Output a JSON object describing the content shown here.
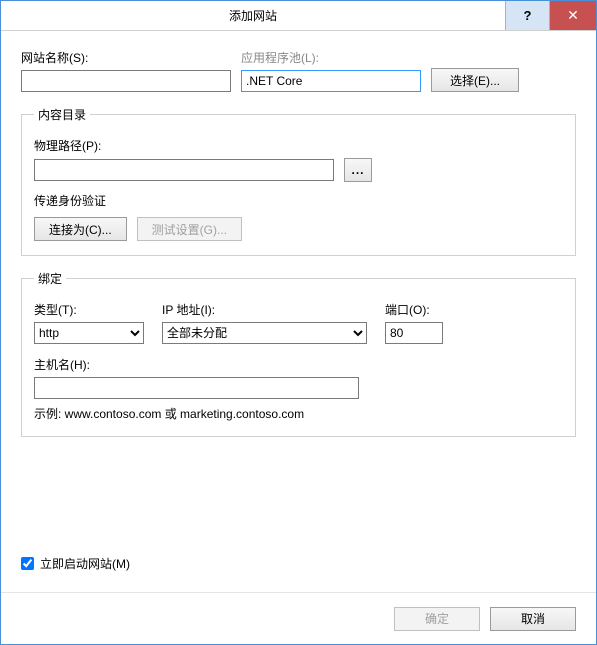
{
  "titlebar": {
    "title": "添加网站",
    "help": "?",
    "close": "✕"
  },
  "site": {
    "name_label": "网站名称(S):",
    "name_value": "",
    "apppool_label": "应用程序池(L):",
    "apppool_value": ".NET Core",
    "select_btn": "选择(E)..."
  },
  "content_dir": {
    "legend": "内容目录",
    "path_label": "物理路径(P):",
    "path_value": "",
    "browse_btn": "...",
    "auth_label": "传递身份验证",
    "connect_as_btn": "连接为(C)...",
    "test_btn": "测试设置(G)..."
  },
  "binding": {
    "legend": "绑定",
    "type_label": "类型(T):",
    "type_value": "http",
    "ip_label": "IP 地址(I):",
    "ip_value": "全部未分配",
    "port_label": "端口(O):",
    "port_value": "80",
    "host_label": "主机名(H):",
    "host_value": "",
    "example": "示例: www.contoso.com 或 marketing.contoso.com"
  },
  "start_site": {
    "label": "立即启动网站(M)",
    "checked": true
  },
  "footer": {
    "ok": "确定",
    "cancel": "取消"
  }
}
